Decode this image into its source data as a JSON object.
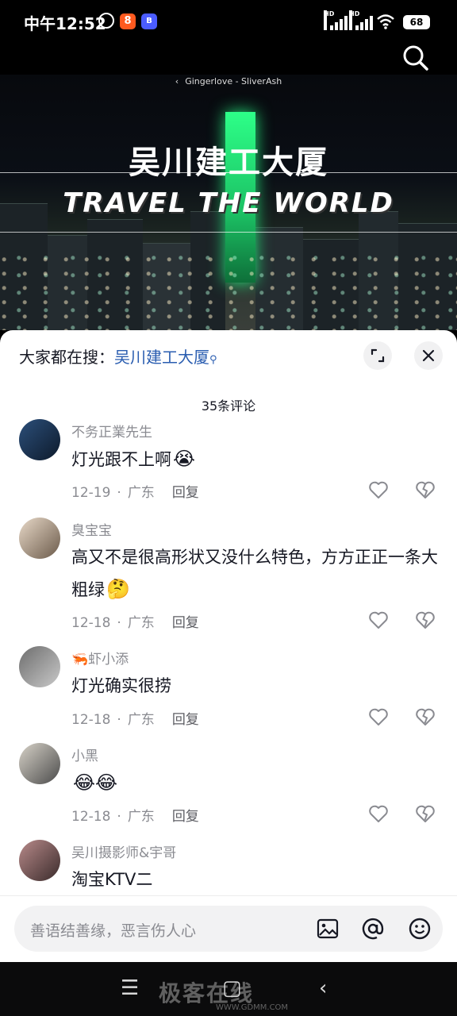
{
  "status_bar": {
    "time": "中午12:52",
    "app_badge_1": "8",
    "app_badge_2": "B",
    "signal_label": "HD",
    "battery": "68"
  },
  "video": {
    "music": "Gingerlove - SliverAsh",
    "location_title": "吴川建工大厦",
    "overlay_text": "TRAVEL THE WORLD"
  },
  "sheet": {
    "hot_search_label": "大家都在搜：",
    "hot_search_keyword": "吴川建工大厦",
    "comment_count": "35条评论"
  },
  "comments": [
    {
      "name": "不务正業先生",
      "text": "灯光跟不上啊",
      "emoji": "😭",
      "date": "12-19",
      "location": "广东",
      "reply": "回复",
      "avatar_colors": [
        "#2c4f7a",
        "#0d1a2b"
      ]
    },
    {
      "name": "臭宝宝",
      "text": "高又不是很高形状又没什么特色，方方正正一条大粗绿",
      "emoji": "🤔",
      "date": "12-18",
      "location": "广东",
      "reply": "回复",
      "avatar_colors": [
        "#e8d9c8",
        "#6b5a4a"
      ]
    },
    {
      "name": "🦐虾小添",
      "text": "灯光确实很捞",
      "emoji": "",
      "date": "12-18",
      "location": "广东",
      "reply": "回复",
      "avatar_colors": [
        "#6d6d6d",
        "#c9c9c9"
      ]
    },
    {
      "name": "小黑",
      "text": "",
      "emoji": "😂😂",
      "date": "12-18",
      "location": "广东",
      "reply": "回复",
      "avatar_colors": [
        "#d7d2c8",
        "#4b4b4b"
      ]
    },
    {
      "name": "吴川摄影师&宇哥",
      "text": "淘宝KTV二",
      "emoji": "",
      "date": "",
      "location": "",
      "reply": "",
      "avatar_colors": [
        "#b88a8a",
        "#3a2b2b"
      ]
    }
  ],
  "input": {
    "placeholder": "善语结善缘，恶言伤人心",
    "icons": [
      "image-icon",
      "at-icon",
      "emoji-icon"
    ]
  },
  "navbar": {
    "watermark": "极客在线",
    "watermark_url": "WWW.GDMM.COM",
    "icons": [
      "menu-icon",
      "home-icon",
      "back-icon"
    ]
  },
  "colors": {
    "accent_link": "#2a5db0",
    "text_primary": "#161823",
    "text_secondary": "#8a8b91",
    "tower_green": "#2dff88"
  }
}
